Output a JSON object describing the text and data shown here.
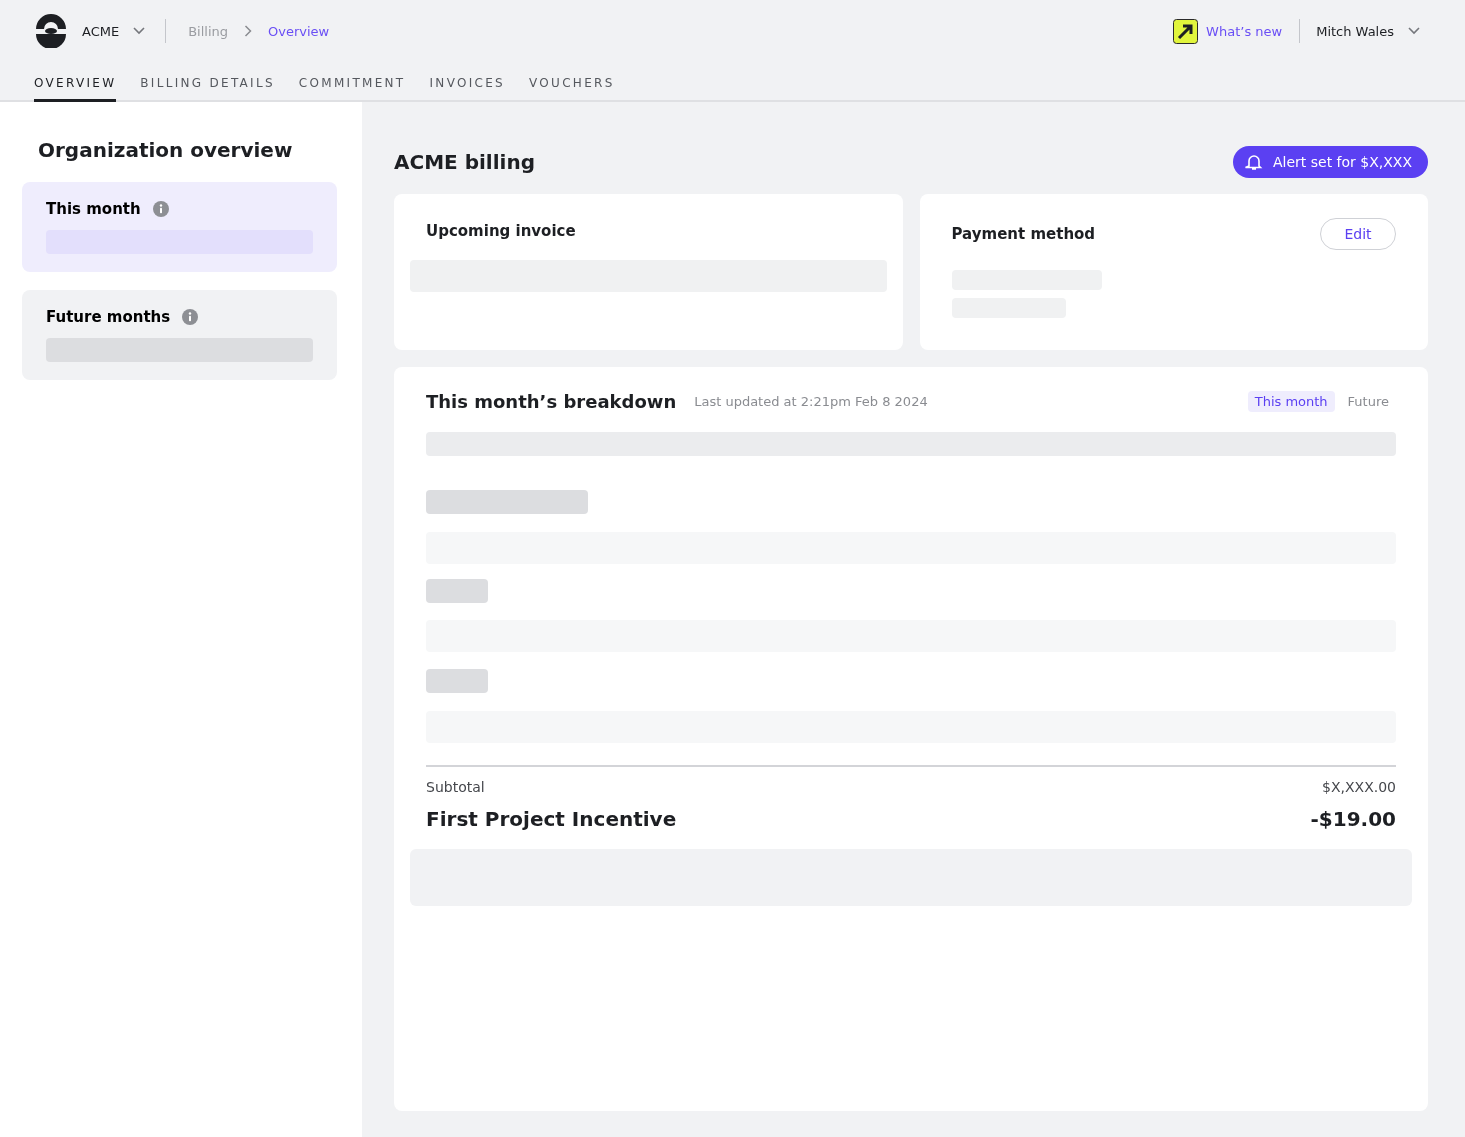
{
  "header": {
    "org": "ACME",
    "breadcrumb": [
      "Billing",
      "Overview"
    ],
    "whats_new": "What’s new",
    "user": "Mitch Wales"
  },
  "tabs": [
    {
      "label": "OVERVIEW",
      "selected": true
    },
    {
      "label": "BILLING DETAILS",
      "selected": false
    },
    {
      "label": "COMMITMENT",
      "selected": false
    },
    {
      "label": "INVOICES",
      "selected": false
    },
    {
      "label": "VOUCHERS",
      "selected": false
    }
  ],
  "sidebar": {
    "title": "Organization overview",
    "items": [
      {
        "label": "This month",
        "selected": true
      },
      {
        "label": "Future months",
        "selected": false
      }
    ]
  },
  "main": {
    "title": "ACME billing",
    "alert_button": "Alert set for $X,XXX",
    "upcoming_invoice": {
      "title": "Upcoming invoice"
    },
    "payment_method": {
      "title": "Payment method",
      "edit_button": "Edit"
    },
    "breakdown": {
      "title": "This month’s breakdown",
      "updated": "Last updated at 2:21pm Feb 8 2024",
      "toggle": [
        {
          "label": "This month",
          "selected": true
        },
        {
          "label": "Future",
          "selected": false
        }
      ],
      "subtotal_label": "Subtotal",
      "subtotal_value": "$X,XXX.00",
      "incentive_label": "First Project Incentive",
      "incentive_value": "-$19.00"
    }
  }
}
